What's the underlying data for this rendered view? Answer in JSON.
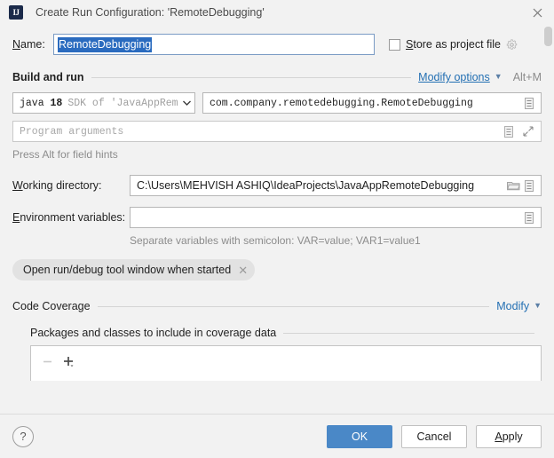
{
  "window": {
    "app_icon": "intellij-idea-icon",
    "title": "Create Run Configuration: 'RemoteDebugging'",
    "close_icon": "close-icon"
  },
  "name_row": {
    "label": "Name:",
    "label_mnemonic": "N",
    "value": "RemoteDebugging",
    "store_checkbox_label": "Store as project file",
    "store_checkbox_mnemonic": "S",
    "store_checked": false,
    "gear_icon": "gear-icon"
  },
  "build_and_run": {
    "section_title": "Build and run",
    "modify_options_label": "Modify options",
    "modify_options_shortcut": "Alt+M",
    "jdk": {
      "name": "java",
      "version": "18",
      "sdk_text": "SDK of 'JavaAppRem",
      "dropdown_icon": "chevron-down-icon"
    },
    "main_class": {
      "value": "com.company.remotedebugging.RemoteDebugging",
      "browse_icon": "list-icon"
    },
    "program_arguments": {
      "placeholder": "Program arguments",
      "browse_icon": "list-icon",
      "expand_icon": "expand-icon"
    },
    "field_hint": "Press Alt for field hints",
    "working_directory": {
      "label": "Working directory:",
      "label_mnemonic": "W",
      "value": "C:\\Users\\MEHVISH ASHIQ\\IdeaProjects\\JavaAppRemoteDebugging",
      "folder_icon": "folder-icon",
      "browse_icon": "list-icon"
    },
    "environment_variables": {
      "label": "Environment variables:",
      "label_mnemonic": "E",
      "value": "",
      "browse_icon": "list-icon",
      "hint": "Separate variables with semicolon: VAR=value; VAR1=value1"
    },
    "option_chip": {
      "label": "Open run/debug tool window when started",
      "remove_icon": "close-icon"
    }
  },
  "code_coverage": {
    "section_title": "Code Coverage",
    "modify_label": "Modify",
    "packages_title": "Packages and classes to include in coverage data",
    "remove_button_icon": "minus-icon",
    "add_button_icon": "plus-icon"
  },
  "footer": {
    "help_label": "?",
    "ok_label": "OK",
    "cancel_label": "Cancel",
    "apply_label": "Apply",
    "apply_mnemonic": "A"
  },
  "colors": {
    "accent_blue": "#4a88c7",
    "link_blue": "#2470b3",
    "selection_blue": "#2a6bbf",
    "dialog_bg": "#f2f2f2",
    "chip_bg": "#e2e2e2"
  }
}
